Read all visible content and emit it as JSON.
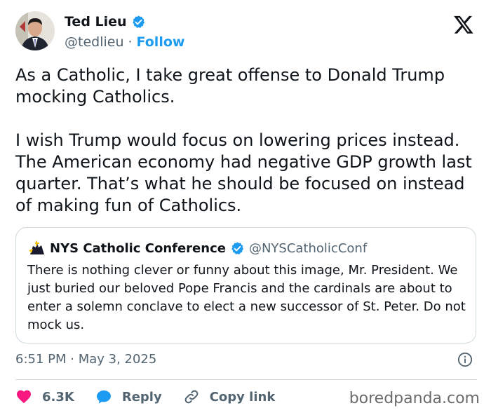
{
  "post": {
    "author_name": "Ted Lieu",
    "author_handle": "@tedlieu",
    "separator": "·",
    "follow_label": "Follow",
    "paragraphs": [
      "As a Catholic, I take great offense to Donald Trump mocking Catholics.",
      "I wish Trump would focus on lowering prices instead. The American economy had negative GDP growth last quarter. That’s what he should be focused on instead of making fun of Catholics."
    ],
    "timestamp": "6:51 PM · May 3, 2025"
  },
  "quote": {
    "author_name": "NYS Catholic Conference",
    "author_handle": "@NYSCatholicConf",
    "text": "There is nothing clever or funny about this image, Mr. President. We just buried our beloved Pope Francis and the cardinals are about to enter a solemn conclave to elect a new successor of St. Peter. Do not mock us."
  },
  "actions": {
    "like_count": "6.3K",
    "reply_label": "Reply",
    "copy_label": "Copy link"
  },
  "watermark": "boredpanda.com",
  "icons": {
    "verified": "verified-badge-icon",
    "platform": "x-logo-icon",
    "like": "heart-icon",
    "reply": "speech-bubble-icon",
    "copy": "link-icon",
    "info": "info-icon"
  },
  "colors": {
    "accent": "#1d9bf0",
    "like": "#f91880",
    "muted_text": "#536471",
    "text": "#0f1419",
    "border": "#cfd9de"
  }
}
